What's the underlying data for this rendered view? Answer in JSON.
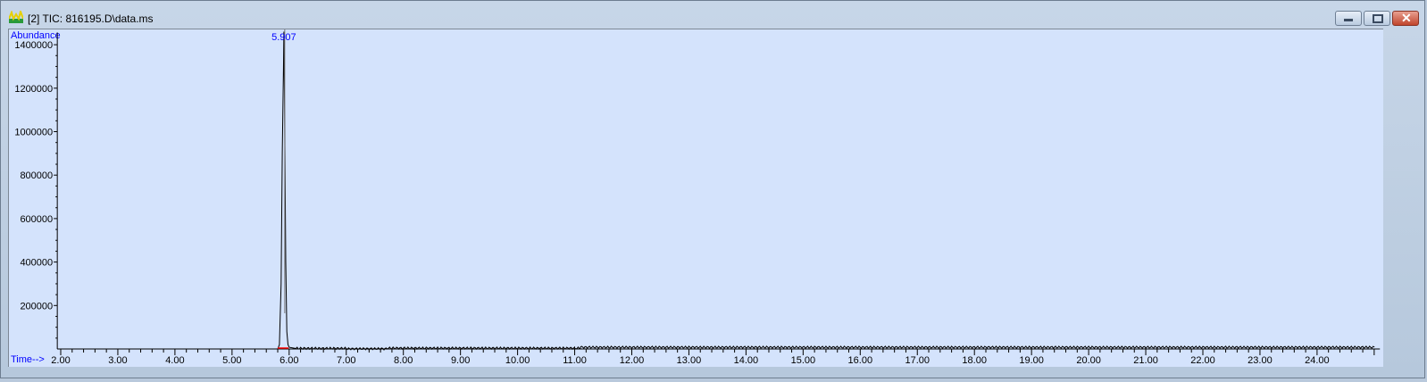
{
  "window": {
    "title": "[2] TIC: 816195.D\\data.ms",
    "icon": "chromatogram-icon",
    "buttons": [
      "minimize",
      "maximize",
      "close"
    ]
  },
  "colors": {
    "background": "#d4e3fc",
    "trace": "#000000",
    "label": "#0000ff",
    "baseline_marker": "#ff0000"
  },
  "chart_data": {
    "type": "line",
    "ylabel": "Abundance",
    "xlabel": "Time-->",
    "xlim": [
      1.94,
      25.1
    ],
    "ylim": [
      0,
      1440000
    ],
    "x_ticks": [
      "2.00",
      "3.00",
      "4.00",
      "5.00",
      "6.00",
      "7.00",
      "8.00",
      "9.00",
      "10.00",
      "11.00",
      "12.00",
      "13.00",
      "14.00",
      "15.00",
      "16.00",
      "17.00",
      "18.00",
      "19.00",
      "20.00",
      "21.00",
      "22.00",
      "23.00",
      "24.00"
    ],
    "y_ticks": [
      "200000",
      "400000",
      "600000",
      "800000",
      "1000000",
      "1200000",
      "1400000"
    ],
    "annotations": [
      {
        "x": 5.907,
        "text": "5.907"
      }
    ],
    "series": [
      {
        "x": [
          1.94,
          5.8,
          5.83,
          5.86,
          5.88,
          5.9,
          5.907,
          5.92,
          5.94,
          5.96,
          5.98,
          6.0,
          6.1,
          7.0,
          7.6,
          7.7,
          11.0,
          11.1,
          25.0
        ],
        "y": [
          0,
          0,
          20000,
          300000,
          900000,
          1280000,
          1460000,
          1100000,
          400000,
          80000,
          20000,
          8000,
          3000,
          1000,
          1000,
          4000,
          4000,
          8000,
          8000
        ]
      }
    ]
  }
}
